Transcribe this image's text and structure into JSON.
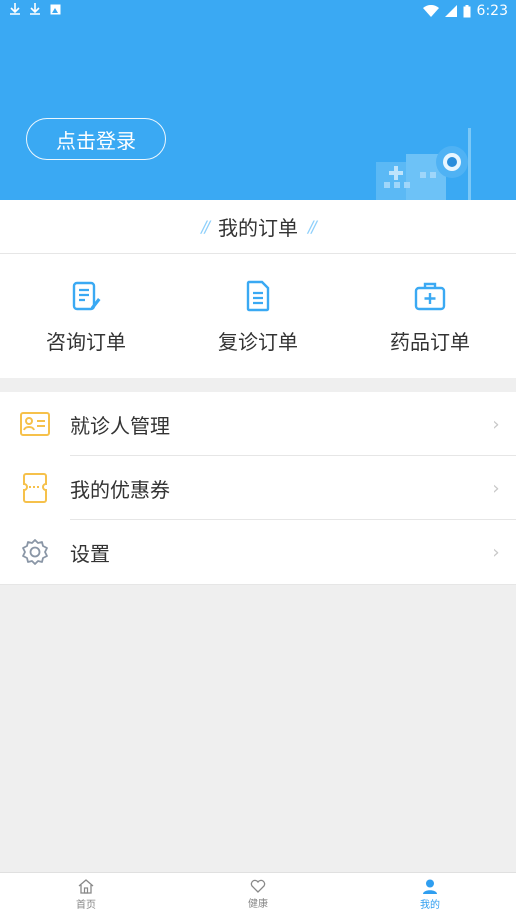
{
  "status_bar": {
    "time": "6:23"
  },
  "header": {
    "login_label": "点击登录"
  },
  "orders": {
    "title": "我的订单",
    "items": [
      {
        "label": "咨询订单",
        "icon": "consult-edit-icon"
      },
      {
        "label": "复诊订单",
        "icon": "document-icon"
      },
      {
        "label": "药品订单",
        "icon": "medicine-kit-icon"
      }
    ]
  },
  "menu": {
    "items": [
      {
        "label": "就诊人管理",
        "icon": "patient-card-icon"
      },
      {
        "label": "我的优惠券",
        "icon": "coupon-icon"
      },
      {
        "label": "设置",
        "icon": "gear-icon"
      }
    ]
  },
  "bottom_nav": {
    "items": [
      {
        "label": "首页",
        "icon": "home-icon"
      },
      {
        "label": "健康",
        "icon": "heart-icon"
      },
      {
        "label": "我的",
        "icon": "person-icon"
      }
    ],
    "active_index": 2
  },
  "colors": {
    "brand": "#3aa9f3",
    "active": "#2f9ef0",
    "coupon": "#f6c14b"
  }
}
